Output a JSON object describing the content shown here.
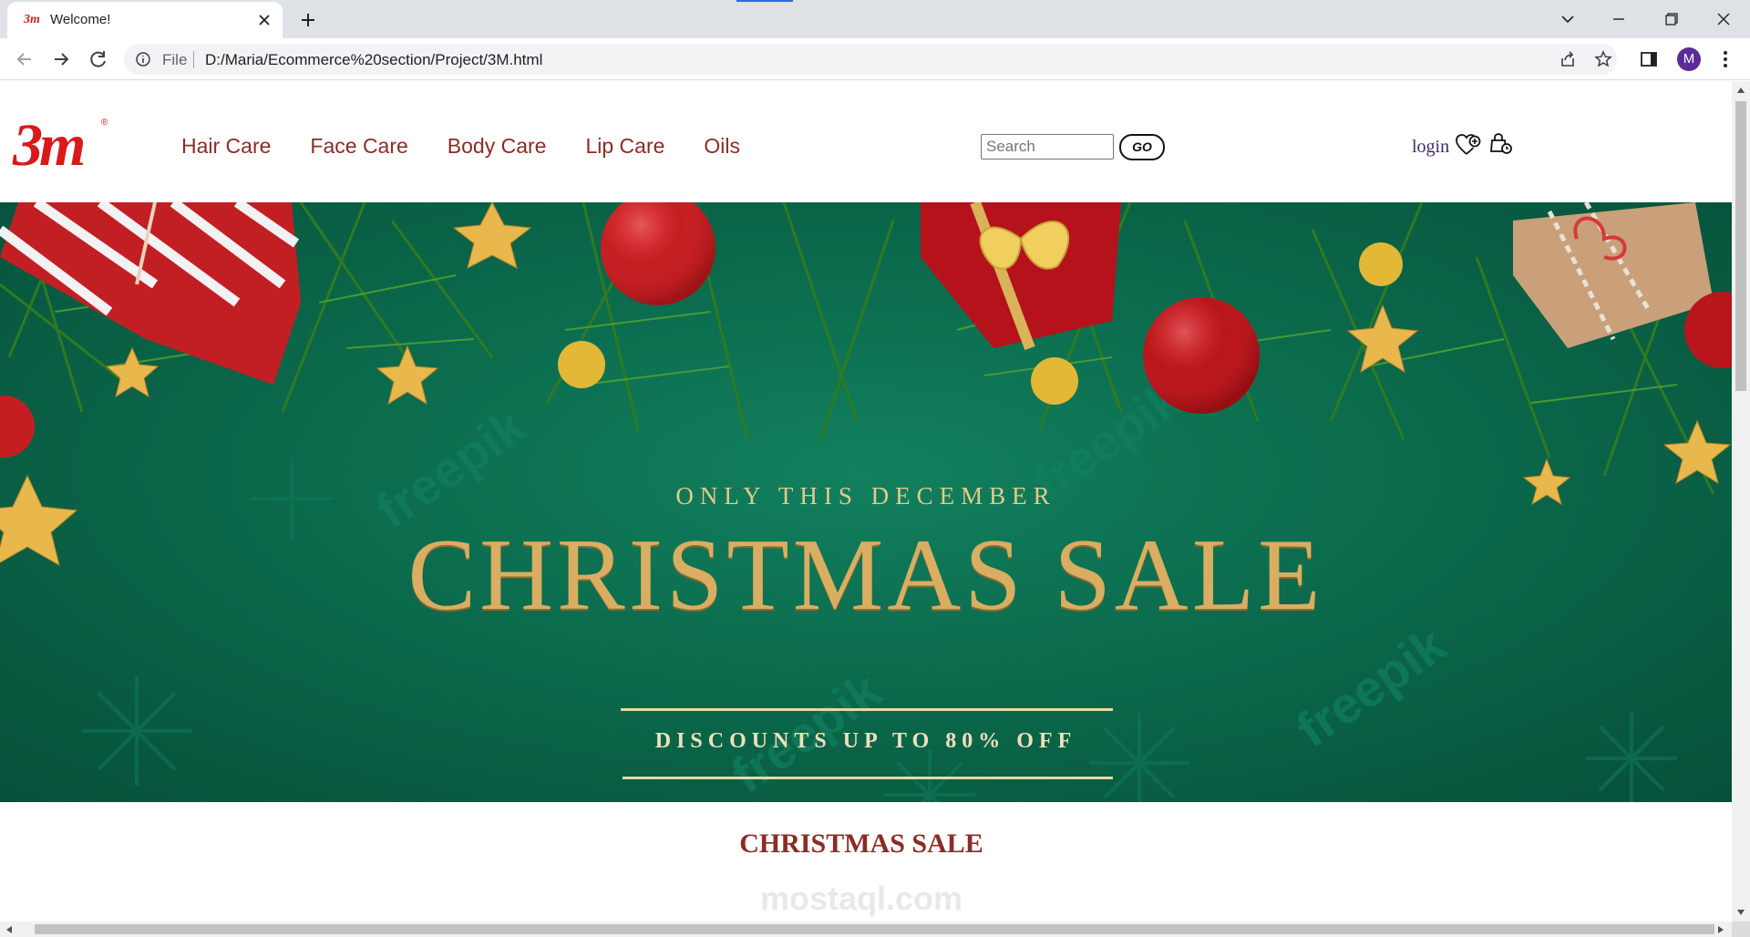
{
  "browser": {
    "tab_title": "Welcome!",
    "favicon_text": "3m",
    "url_scheme_label": "File",
    "url": "D:/Maria/Ecommerce%20section/Project/3M.html",
    "profile_initial": "M"
  },
  "site": {
    "logo_text": "3m",
    "logo_mark": "®",
    "nav": [
      "Hair Care",
      "Face Care",
      "Body Care",
      "Lip Care",
      "Oils"
    ],
    "search_placeholder": "Search",
    "search_button": "GO",
    "login_label": "login",
    "icons": {
      "wishlist": "heart-plus-icon",
      "cart": "shopping-bag-icon"
    }
  },
  "hero": {
    "subtitle": "ONLY THIS DECEMBER",
    "title": "CHRISTMAS SALE",
    "discount": "DISCOUNTS UP TO 80% OFF",
    "watermark": "freepik"
  },
  "section": {
    "title": "CHRISTMAS SALE"
  },
  "overlay_watermark": "mostaql.com",
  "colors": {
    "brand_red": "#d91a1a",
    "nav_text": "#8b2c25",
    "hero_green": "#0b6a4c",
    "gold": "#d9ae62"
  }
}
